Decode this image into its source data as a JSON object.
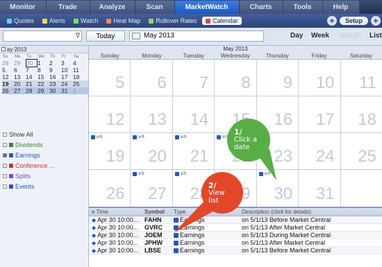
{
  "nav": {
    "tabs": [
      "Monitor",
      "Trade",
      "Analyze",
      "Scan",
      "MarketWatch",
      "Charts",
      "Tools",
      "Help"
    ],
    "active_tab": "MarketWatch"
  },
  "subnav": {
    "items": [
      {
        "label": "Quotes",
        "icon": "plus-icon",
        "color": "#5fd0ff"
      },
      {
        "label": "Alerts",
        "icon": "bell-icon",
        "color": "#ffd45a"
      },
      {
        "label": "Watch",
        "icon": "grid-icon",
        "color": "#7bdc6a"
      },
      {
        "label": "Heat Map",
        "icon": "heatmap-icon",
        "color": "#ff8a5a"
      },
      {
        "label": "Rollover Rates",
        "icon": "rollover-icon",
        "color": "#9bd06a"
      },
      {
        "label": "Calendar",
        "icon": "calendar-icon",
        "color": "#d84a4a"
      }
    ],
    "active": "Calendar",
    "setup_label": "Setup"
  },
  "controls": {
    "today_label": "Today",
    "date_value": "May 2013",
    "views": [
      "Day",
      "Week",
      "Month",
      "List"
    ]
  },
  "mini_calendar": {
    "month_label": "ay 2013",
    "dow": [
      "Su",
      "Mo",
      "Tu",
      "We",
      "Th",
      "Fr",
      "Sa"
    ],
    "weeks": [
      [
        "28",
        "29",
        "30",
        "1",
        "2",
        "3",
        "4"
      ],
      [
        "5",
        "6",
        "7",
        "8",
        "9",
        "10",
        "11"
      ],
      [
        "12",
        "13",
        "14",
        "15",
        "16",
        "17",
        "18"
      ],
      [
        "19",
        "20",
        "21",
        "22",
        "23",
        "24",
        "25"
      ],
      [
        "26",
        "27",
        "28",
        "29",
        "30",
        "31",
        "1"
      ]
    ]
  },
  "filters": [
    {
      "label": "Show All",
      "color": "#334455",
      "checked": false
    },
    {
      "label": "Dividends",
      "color": "#2e8b2e",
      "checked": false
    },
    {
      "label": "Earnings",
      "color": "#2a55b7",
      "checked": true
    },
    {
      "label": "Conference ...",
      "color": "#c0392b",
      "checked": false
    },
    {
      "label": "Splits",
      "color": "#7a4fb0",
      "checked": false
    },
    {
      "label": "Events",
      "color": "#2a55b7",
      "checked": false
    }
  ],
  "calendar": {
    "title": "May 2013",
    "dow": [
      "Sunday",
      "Monday",
      "Tuesday",
      "Wednesday",
      "Thursday",
      "Friday",
      "Saturday"
    ],
    "weeks": [
      [
        "5",
        "6",
        "7",
        "8",
        "9",
        "10",
        "11"
      ],
      [
        "12",
        "13",
        "14",
        "15",
        "16",
        "17",
        "18"
      ],
      [
        "19",
        "20",
        "21",
        "22",
        "23",
        "24",
        "25"
      ],
      [
        "26",
        "27",
        "28",
        "29",
        "30",
        "31",
        ""
      ]
    ],
    "event_label": "e/9"
  },
  "list": {
    "headers": [
      "e Time",
      "Symbol",
      "Type",
      "Description (click for details)"
    ],
    "rows": [
      {
        "time": "Apr 30 10:00...",
        "symbol": "FAHN",
        "type": "Earnings",
        "desc": "on 5/1/13 Before Market Central"
      },
      {
        "time": "Apr 30 10:00...",
        "symbol": "GVRC",
        "type": "Earnings",
        "desc": "on 5/1/13 After Market Central"
      },
      {
        "time": "Apr 30 10:00...",
        "symbol": "JOEM",
        "type": "Earnings",
        "desc": "on 5/1/13 During Market Central"
      },
      {
        "time": "Apr 30 10:00...",
        "symbol": "JPHW",
        "type": "Earnings",
        "desc": "on 5/1/13 After Market Central"
      },
      {
        "time": "Apr 30 10:00...",
        "symbol": "LBSE",
        "type": "Earnings",
        "desc": "on 5/1/13 Before Market Central"
      }
    ]
  },
  "callouts": {
    "green": {
      "num": "1/",
      "line1": "Click a",
      "line2": "date",
      "color": "#58ae45"
    },
    "red": {
      "num": "2/",
      "line1": "View",
      "line2": "list",
      "color": "#e2472a"
    }
  }
}
